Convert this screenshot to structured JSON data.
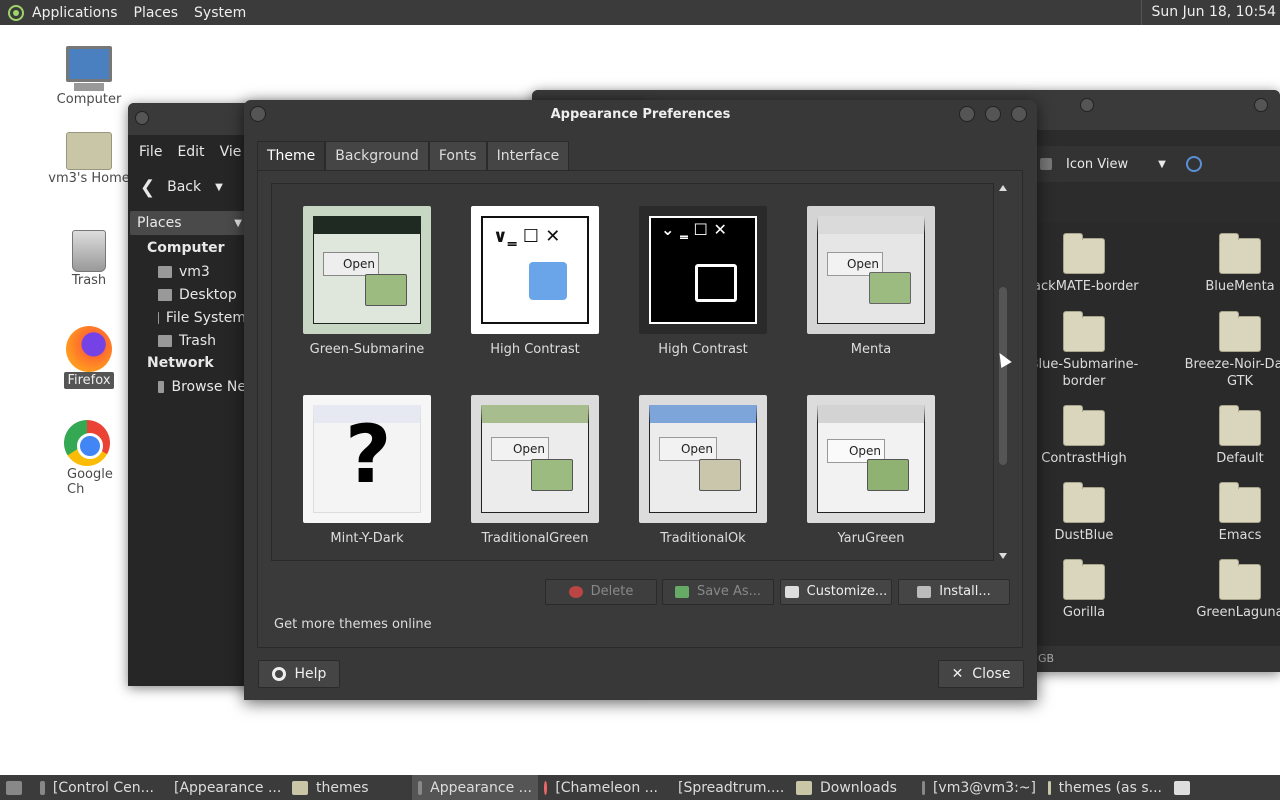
{
  "topbar": {
    "applications": "Applications",
    "places": "Places",
    "system": "System",
    "clock": "Sun Jun 18, 10:54"
  },
  "desktop": {
    "icons": [
      {
        "label": "Computer"
      },
      {
        "label": "vm3's Home"
      },
      {
        "label": "Trash"
      },
      {
        "label": "Firefox"
      },
      {
        "label": "Google Ch"
      }
    ]
  },
  "fm_left": {
    "menu": [
      "File",
      "Edit",
      "Vie"
    ],
    "back": "Back",
    "places_header": "Places",
    "computer_section": "Computer",
    "places": [
      "vm3",
      "Desktop",
      "File System",
      "Trash"
    ],
    "network_section": "Network",
    "network_items": [
      "Browse Ne"
    ]
  },
  "fm_right": {
    "view_mode": "Icon View",
    "status": "GB",
    "folders": [
      "lackMATE-border",
      "BlueMenta",
      "Blue-Submarine-border",
      "Breeze-Noir-Dark GTK",
      "ContrastHigh",
      "Default",
      "DustBlue",
      "Emacs",
      "Gorilla",
      "GreenLaguna"
    ]
  },
  "dialog": {
    "title": "Appearance Preferences",
    "tabs": [
      "Theme",
      "Background",
      "Fonts",
      "Interface"
    ],
    "themes": [
      {
        "name": "Green-Submarine"
      },
      {
        "name": "High Contrast"
      },
      {
        "name": "High Contrast"
      },
      {
        "name": "Menta"
      },
      {
        "name": "Mint-Y-Dark"
      },
      {
        "name": "TraditionalGreen"
      },
      {
        "name": "TraditionalOk"
      },
      {
        "name": "YaruGreen"
      }
    ],
    "thumb_open_text": "Open",
    "buttons": {
      "delete": "Delete",
      "save_as": "Save As...",
      "customize": "Customize...",
      "install": "Install..."
    },
    "get_more": "Get more themes online",
    "help": "Help",
    "close": "Close"
  },
  "taskbar": [
    "[Control Cen...",
    "[Appearance ...",
    "themes",
    "Appearance ...",
    "[Chameleon ...",
    "[Spreadtrum....",
    "Downloads",
    "[vm3@vm3:~]",
    "themes (as s..."
  ]
}
